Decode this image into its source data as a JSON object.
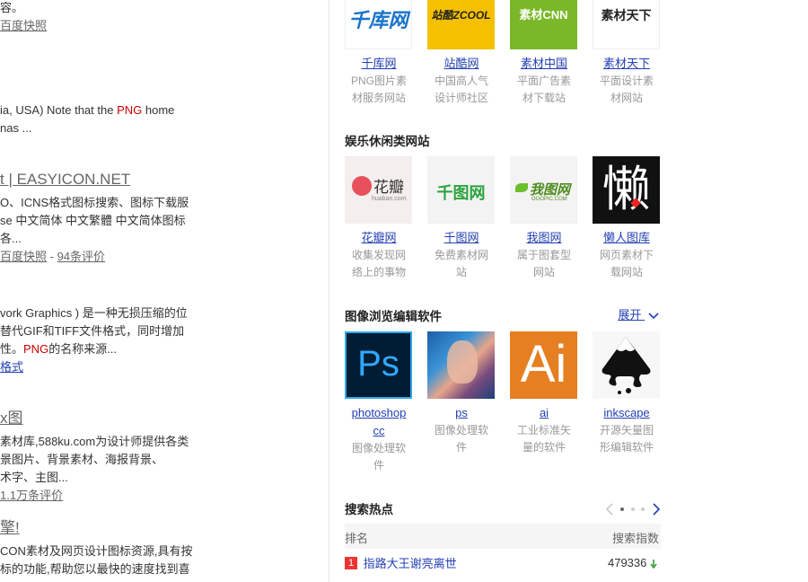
{
  "left": {
    "r1_line1": "容。",
    "r1_snap": "百度快照",
    "r2_line1_pre": "ia, USA) Note that the ",
    "r2_line1_hl": "PNG",
    "r2_line1_post": " home",
    "r2_line2": "nas ...",
    "r3_title": "t | EASYICON.NET",
    "r3_line1": "O、ICNS格式图标搜索、图标下载服",
    "r3_line2": "se 中文简体 中文繁體 中文简体图标",
    "r3_line3": "各...",
    "r3_snap": "百度快照",
    "r3_sep": " - ",
    "r3_reviews": "94条评价",
    "r4_line1": "vork Graphics ) 是一种无损压缩的位",
    "r4_line2": "替代GIF和TIFF文件格式，同时增加",
    "r4_line3_pre": "性。",
    "r4_line3_hl": "PNG",
    "r4_line3_post": "的名称来源...",
    "r4_link": "格式",
    "r5_title": "x图",
    "r5_line1": "素材库,588ku.com为设计师提供各类",
    "r5_line2": "景图片、背景素材、海报背景、",
    "r5_line3": "术字、主图...",
    "r5_reviews": "1.1万条评价",
    "r6_title": "擎!",
    "r6_line1": "CON素材及网页设计图标资源,具有按",
    "r6_line2": "标的功能,帮助您以最快的速度找到喜"
  },
  "row1": [
    {
      "name": "千库网",
      "desc1": "PNG图片素",
      "desc2": "材服务网站",
      "logo": "千库网",
      "bg": "#ffffff",
      "fg": "#1a73c9"
    },
    {
      "name": "站酷网",
      "desc1": "中国高人气",
      "desc2": "设计师社区",
      "logo": "站酷ZCOOL",
      "bg": "#f5c000",
      "fg": "#222222"
    },
    {
      "name": "素材中国",
      "desc1": "平面广告素",
      "desc2": "材下载站",
      "logo": "素材CNN",
      "bg": "#7ab829",
      "fg": "#ffffff"
    },
    {
      "name": "素材天下",
      "desc1": "平面设计素",
      "desc2": "材网站",
      "logo": "素材天下",
      "bg": "#ffffff",
      "fg": "#222222"
    }
  ],
  "sec_ent": "娱乐休闲类网站",
  "row2": [
    {
      "name": "花瓣网",
      "desc1": "收集发现网",
      "desc2": "络上的事物",
      "logo": "花瓣",
      "sub": "huaban.com"
    },
    {
      "name": "千图网",
      "desc1": "免费素材网",
      "desc2": "站",
      "logo": "千图网",
      "sub": ""
    },
    {
      "name": "我图网",
      "desc1": "属于图套型",
      "desc2": "网站",
      "logo": "我图网",
      "sub": "OOOPIC.COM"
    },
    {
      "name": "懒人图库",
      "desc1": "网页素材下",
      "desc2": "载网站",
      "logo": "懒",
      "sub": ""
    }
  ],
  "sec_img": "图像浏览编辑软件",
  "expand": "展开",
  "row3": [
    {
      "name1": "photoshop",
      "name2": "cc",
      "desc1": "图像处理软",
      "desc2": "件",
      "logo": "Ps"
    },
    {
      "name1": "ps",
      "name2": "",
      "desc1": "图像处理软",
      "desc2": "件",
      "logo": ""
    },
    {
      "name1": "ai",
      "name2": "",
      "desc1": "工业标准矢",
      "desc2": "量的软件",
      "logo": "Ai"
    },
    {
      "name1": "inkscape",
      "name2": "",
      "desc1": "开源矢量图",
      "desc2": "形编辑软件",
      "logo": ""
    }
  ],
  "hot": {
    "title": "搜索热点",
    "col_rank": "排名",
    "col_index": "搜索指数",
    "rows": [
      {
        "rank": "1",
        "term": "指路大王谢亮离世",
        "index": "479336"
      }
    ]
  },
  "colors": {
    "link": "#2440b3",
    "highlight": "#c00000",
    "rank1": "#e33333",
    "trend_down": "#3a9c3a"
  }
}
